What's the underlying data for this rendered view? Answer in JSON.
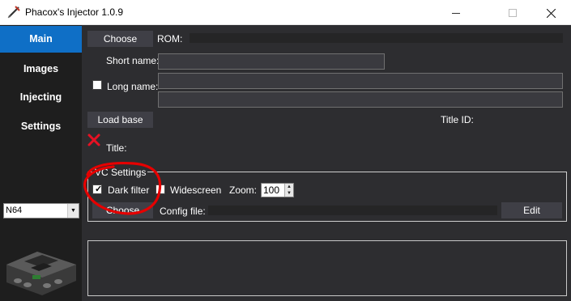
{
  "window": {
    "title": "Phacox's Injector 1.0.9"
  },
  "sidebar": {
    "items": [
      {
        "label": "Main",
        "active": true
      },
      {
        "label": "Images",
        "active": false
      },
      {
        "label": "Injecting",
        "active": false
      },
      {
        "label": "Settings",
        "active": false
      }
    ],
    "console_select": {
      "value": "N64"
    }
  },
  "main": {
    "choose_rom_label": "Choose",
    "rom_label": "ROM:",
    "rom_value": "",
    "short_name_label": "Short name:",
    "short_name_value": "",
    "long_name_label": "Long name:",
    "long_name_checked": false,
    "long_name_line1": "",
    "long_name_line2": "",
    "load_base_label": "Load base",
    "title_id_label": "Title ID:",
    "title_label": "Title:"
  },
  "vc_settings": {
    "legend": "VC Settings",
    "dark_filter_label": "Dark filter",
    "dark_filter_checked": true,
    "widescreen_label": "Widescreen",
    "widescreen_checked": false,
    "zoom_label": "Zoom:",
    "zoom_value": "100",
    "choose_config_label": "Choose",
    "config_file_label": "Config file:",
    "config_file_value": "",
    "edit_label": "Edit"
  },
  "log": {
    "text": ""
  },
  "colors": {
    "accent": "#0f6fc6",
    "background": "#2d2d30",
    "sidebar": "#1e1e1e",
    "error": "#e81123",
    "annotation": "#e60000"
  },
  "icons": {
    "app": "syringe-icon",
    "status": "red-x-icon",
    "console": "n64-console-icon"
  }
}
